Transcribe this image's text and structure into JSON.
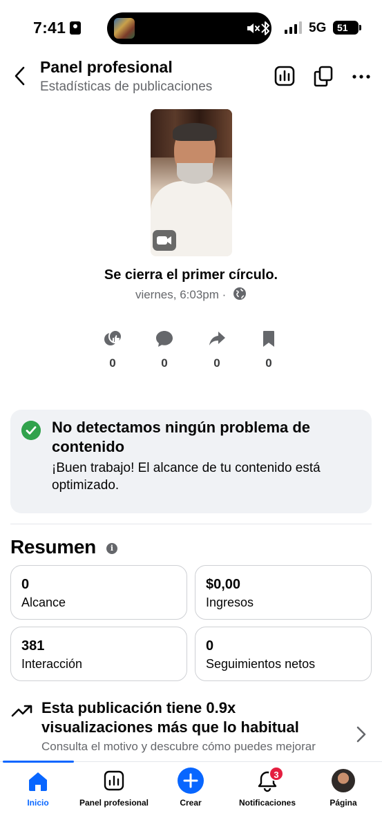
{
  "status_bar": {
    "time": "7:41",
    "network": "5G",
    "battery": "51"
  },
  "header": {
    "title": "Panel profesional",
    "subtitle": "Estadísticas de publicaciones",
    "icons": [
      "chevron-left-icon",
      "insights-icon",
      "copy-icon",
      "more-icon"
    ]
  },
  "post": {
    "title": "Se cierra el primer círculo.",
    "meta": "viernes, 6:03pm ·",
    "metrics": [
      {
        "icon": "reactions-icon",
        "value": "0"
      },
      {
        "icon": "comment-icon",
        "value": "0"
      },
      {
        "icon": "share-icon",
        "value": "0"
      },
      {
        "icon": "bookmark-icon",
        "value": "0"
      }
    ]
  },
  "content_check": {
    "title": "No detectamos ningún problema de contenido",
    "body": "¡Buen trabajo! El alcance de tu contenido está optimizado."
  },
  "summary": {
    "title": "Resumen",
    "stats": [
      {
        "value": "0",
        "label": "Alcance"
      },
      {
        "value": "$0,00",
        "label": "Ingresos"
      },
      {
        "value": "381",
        "label": "Interacción"
      },
      {
        "value": "0",
        "label": "Seguimientos netos"
      }
    ]
  },
  "insight": {
    "title": "Esta publicación tiene 0.9x visualizaciones más que lo habitual",
    "subtitle": "Consulta el motivo y descubre cómo puedes mejorar"
  },
  "tabbar": {
    "tabs": [
      {
        "label": "Inicio",
        "icon": "home-icon",
        "active": true
      },
      {
        "label": "Panel profesional",
        "icon": "insights-icon"
      },
      {
        "label": "Crear",
        "icon": "plus-icon"
      },
      {
        "label": "Notificaciones",
        "icon": "bell-icon",
        "badge": "3"
      },
      {
        "label": "Página",
        "icon": "avatar"
      }
    ]
  },
  "colors": {
    "accent": "#0866ff",
    "success": "#31a24c",
    "badge": "#e41e3f",
    "muted": "#65676b"
  }
}
